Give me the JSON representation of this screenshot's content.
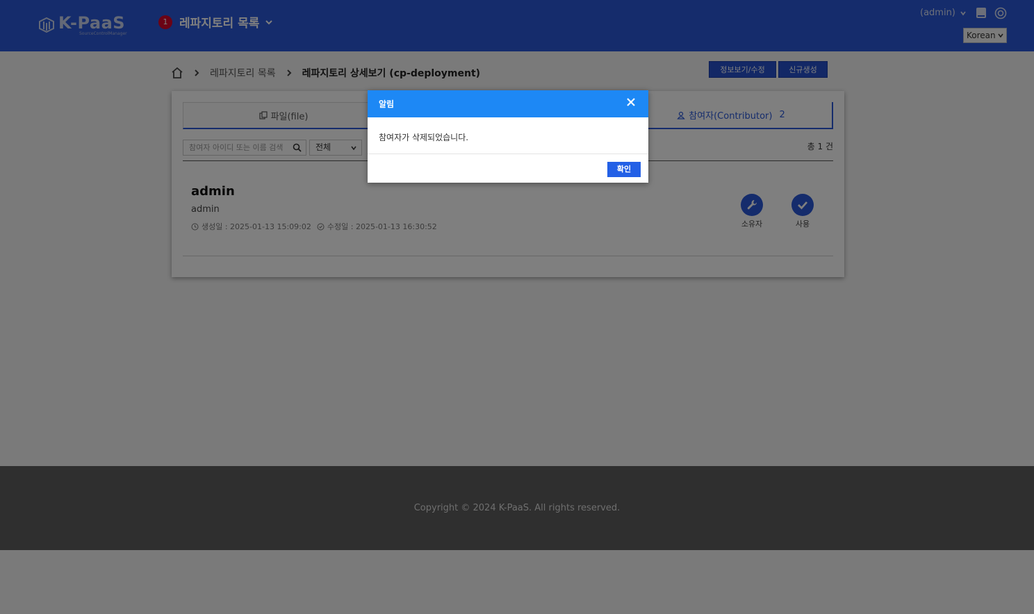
{
  "header": {
    "logo_text": "K-PaaS",
    "logo_sub": "SourceControlManager",
    "repo_badge": "1",
    "repo_menu_label": "레파지토리 목록",
    "user_name": "(admin)",
    "language": "Korean"
  },
  "breadcrumb": {
    "items": [
      "레파지토리 목록"
    ],
    "current": "레파지토리 상세보기 (cp-deployment)"
  },
  "actions": {
    "info_edit": "정보보기/수정",
    "create_new": "신규생성"
  },
  "tabs": {
    "file_label": "파일(file)",
    "contributor_label": "참여자(Contributor)",
    "contributor_count": "2"
  },
  "filters": {
    "search_placeholder": "참여자 아이디 또는 이름 검색",
    "filter_value": "전체",
    "total": "총 1 건"
  },
  "contributors": [
    {
      "name": "admin",
      "id": "admin",
      "created": "생성일 : 2025-01-13 15:09:02",
      "modified": "수정일 : 2025-01-13 16:30:52",
      "role_label": "소유자",
      "status_label": "사용"
    }
  ],
  "footer": {
    "copyright": "Copyright © 2024 K-PaaS. All rights reserved."
  },
  "modal": {
    "title": "알림",
    "message": "참여자가 삭제되었습니다.",
    "ok_label": "확인"
  },
  "colors": {
    "header_bg": "#2a58d9",
    "modal_header": "#1d88f5",
    "badge": "#d6062a",
    "primary": "#2360e6"
  }
}
